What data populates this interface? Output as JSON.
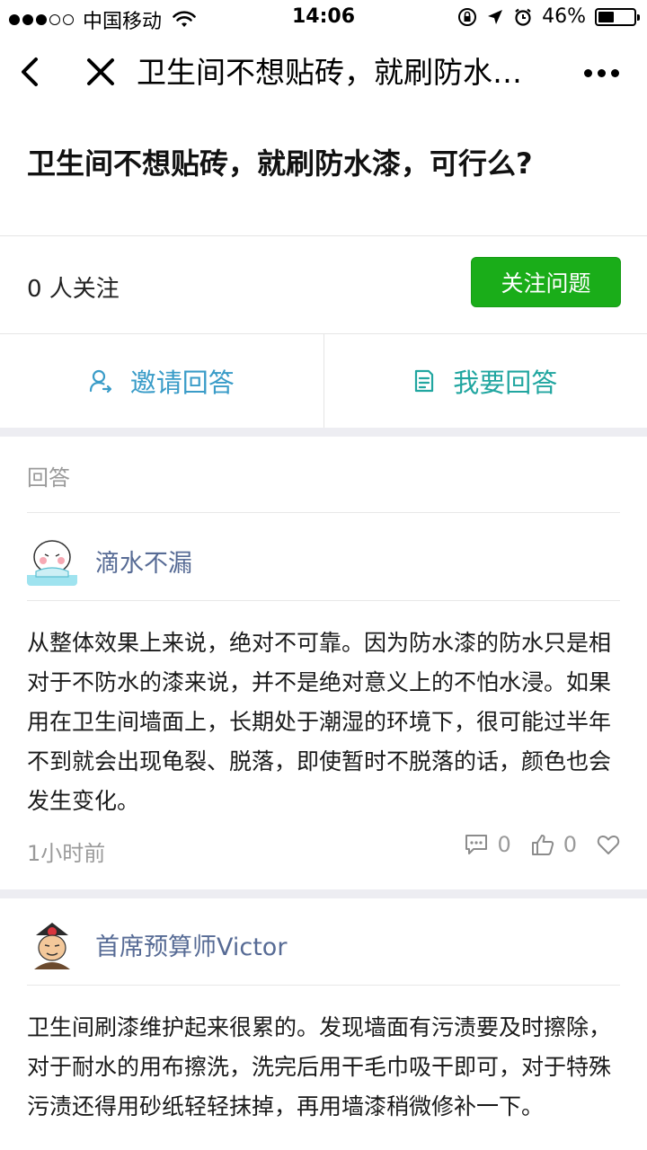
{
  "status_bar": {
    "carrier": "中国移动",
    "time": "14:06",
    "battery_percent": "46%",
    "battery_level": 0.46
  },
  "nav": {
    "title": "卫生间不想贴砖，就刷防水…",
    "back_icon": "chevron-left-icon",
    "close_icon": "close-icon",
    "more_icon": "more-dots-icon"
  },
  "question": {
    "title": "卫生间不想贴砖，就刷防水漆，可行么?",
    "follow_count": "0 人关注",
    "follow_button": "关注问题",
    "follow_button_color": "#1aad19"
  },
  "actions": {
    "invite_label": "邀请回答",
    "answer_label": "我要回答"
  },
  "answers_section_label": "回答",
  "answers": [
    {
      "author": "滴水不漏",
      "body": "从整体效果上来说，绝对不可靠。因为防水漆的防水只是相对于不防水的漆来说，并不是绝对意义上的不怕水浸。如果用在卫生间墙面上，长期处于潮湿的环境下，很可能过半年不到就会出现龟裂、脱落，即使暂时不脱落的话，颜色也会发生变化。",
      "time": "1小时前",
      "comments": "0",
      "likes": "0"
    },
    {
      "author": "首席预算师Victor",
      "body": "卫生间刷漆维护起来很累的。发现墙面有污渍要及时擦除，对于耐水的用布擦洗，洗完后用干毛巾吸干即可，对于特殊污渍还得用砂纸轻轻抹掉，再用墙漆稍微修补一下。"
    }
  ]
}
